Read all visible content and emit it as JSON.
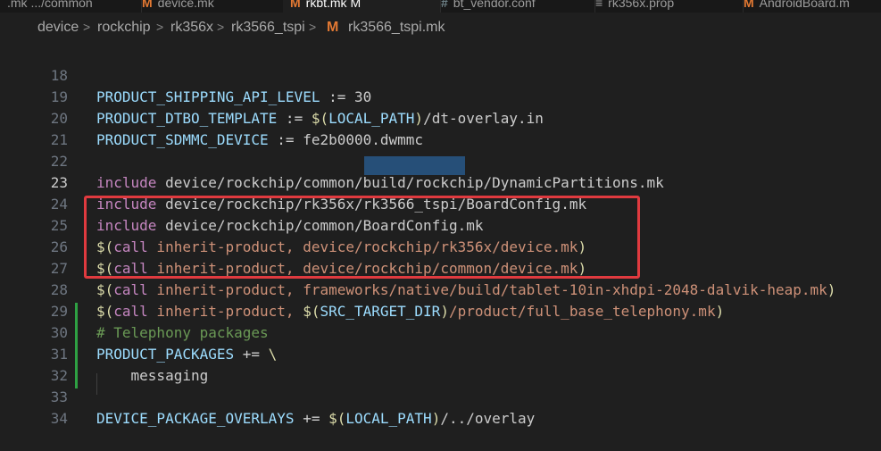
{
  "tabs": [
    {
      "icon": "",
      "label": ".mk  .../common",
      "icon_name": "makefile-icon"
    },
    {
      "icon": "M",
      "label": "device.mk",
      "icon_name": "makefile-icon"
    },
    {
      "icon": "M",
      "label": "rkbt.mk  M",
      "icon_name": "makefile-icon"
    },
    {
      "icon": "#",
      "label": "bt_vendor.conf",
      "icon_name": "config-file-icon"
    },
    {
      "icon": "≡",
      "label": "rk356x.prop",
      "icon_name": "properties-file-icon"
    },
    {
      "icon": "M",
      "label": "AndroidBoard.m",
      "icon_name": "makefile-icon"
    }
  ],
  "breadcrumb": {
    "items": [
      "device",
      "rockchip",
      "rk356x",
      "rk3566_tspi"
    ],
    "separator": ">",
    "file_icon": "M",
    "file_name": "rk3566_tspi.mk"
  },
  "editor": {
    "lines": [
      {
        "num": "18",
        "text": "PRODUCT_SHIPPING_API_LEVEL := 30"
      },
      {
        "num": "19",
        "text": "PRODUCT_DTBO_TEMPLATE := $(LOCAL_PATH)/dt-overlay.in"
      },
      {
        "num": "20",
        "text": "PRODUCT_SDMMC_DEVICE := fe2b0000.dwmmc"
      },
      {
        "num": "21",
        "text": ""
      },
      {
        "num": "22",
        "text": "include device/rockchip/common/build/rockchip/DynamicPartitions.mk"
      },
      {
        "num": "23",
        "text": "include device/rockchip/rk356x/rk3566_tspi/BoardConfig.mk"
      },
      {
        "num": "24",
        "text": "include device/rockchip/common/BoardConfig.mk"
      },
      {
        "num": "25",
        "text": "$(call inherit-product, device/rockchip/rk356x/device.mk)"
      },
      {
        "num": "26",
        "text": "$(call inherit-product, device/rockchip/common/device.mk)"
      },
      {
        "num": "27",
        "text": "$(call inherit-product, frameworks/native/build/tablet-10in-xhdpi-2048-dalvik-heap.mk)"
      },
      {
        "num": "28",
        "text": "$(call inherit-product, $(SRC_TARGET_DIR)/product/full_base_telephony.mk)"
      },
      {
        "num": "29",
        "text": "# Telephony packages"
      },
      {
        "num": "30",
        "text": "PRODUCT_PACKAGES += \\"
      },
      {
        "num": "31",
        "text": "    messaging"
      },
      {
        "num": "32",
        "text": ""
      },
      {
        "num": "33",
        "text": "DEVICE_PACKAGE_OVERLAYS += $(LOCAL_PATH)/../overlay"
      },
      {
        "num": "34",
        "text": ""
      }
    ],
    "current_line": "23",
    "selected_text": "rk3566_tspi"
  },
  "colors": {
    "highlight_border": "#e03a3f",
    "selection": "#264f78",
    "git_added": "#2ea043",
    "makefile_icon": "#e37933"
  }
}
